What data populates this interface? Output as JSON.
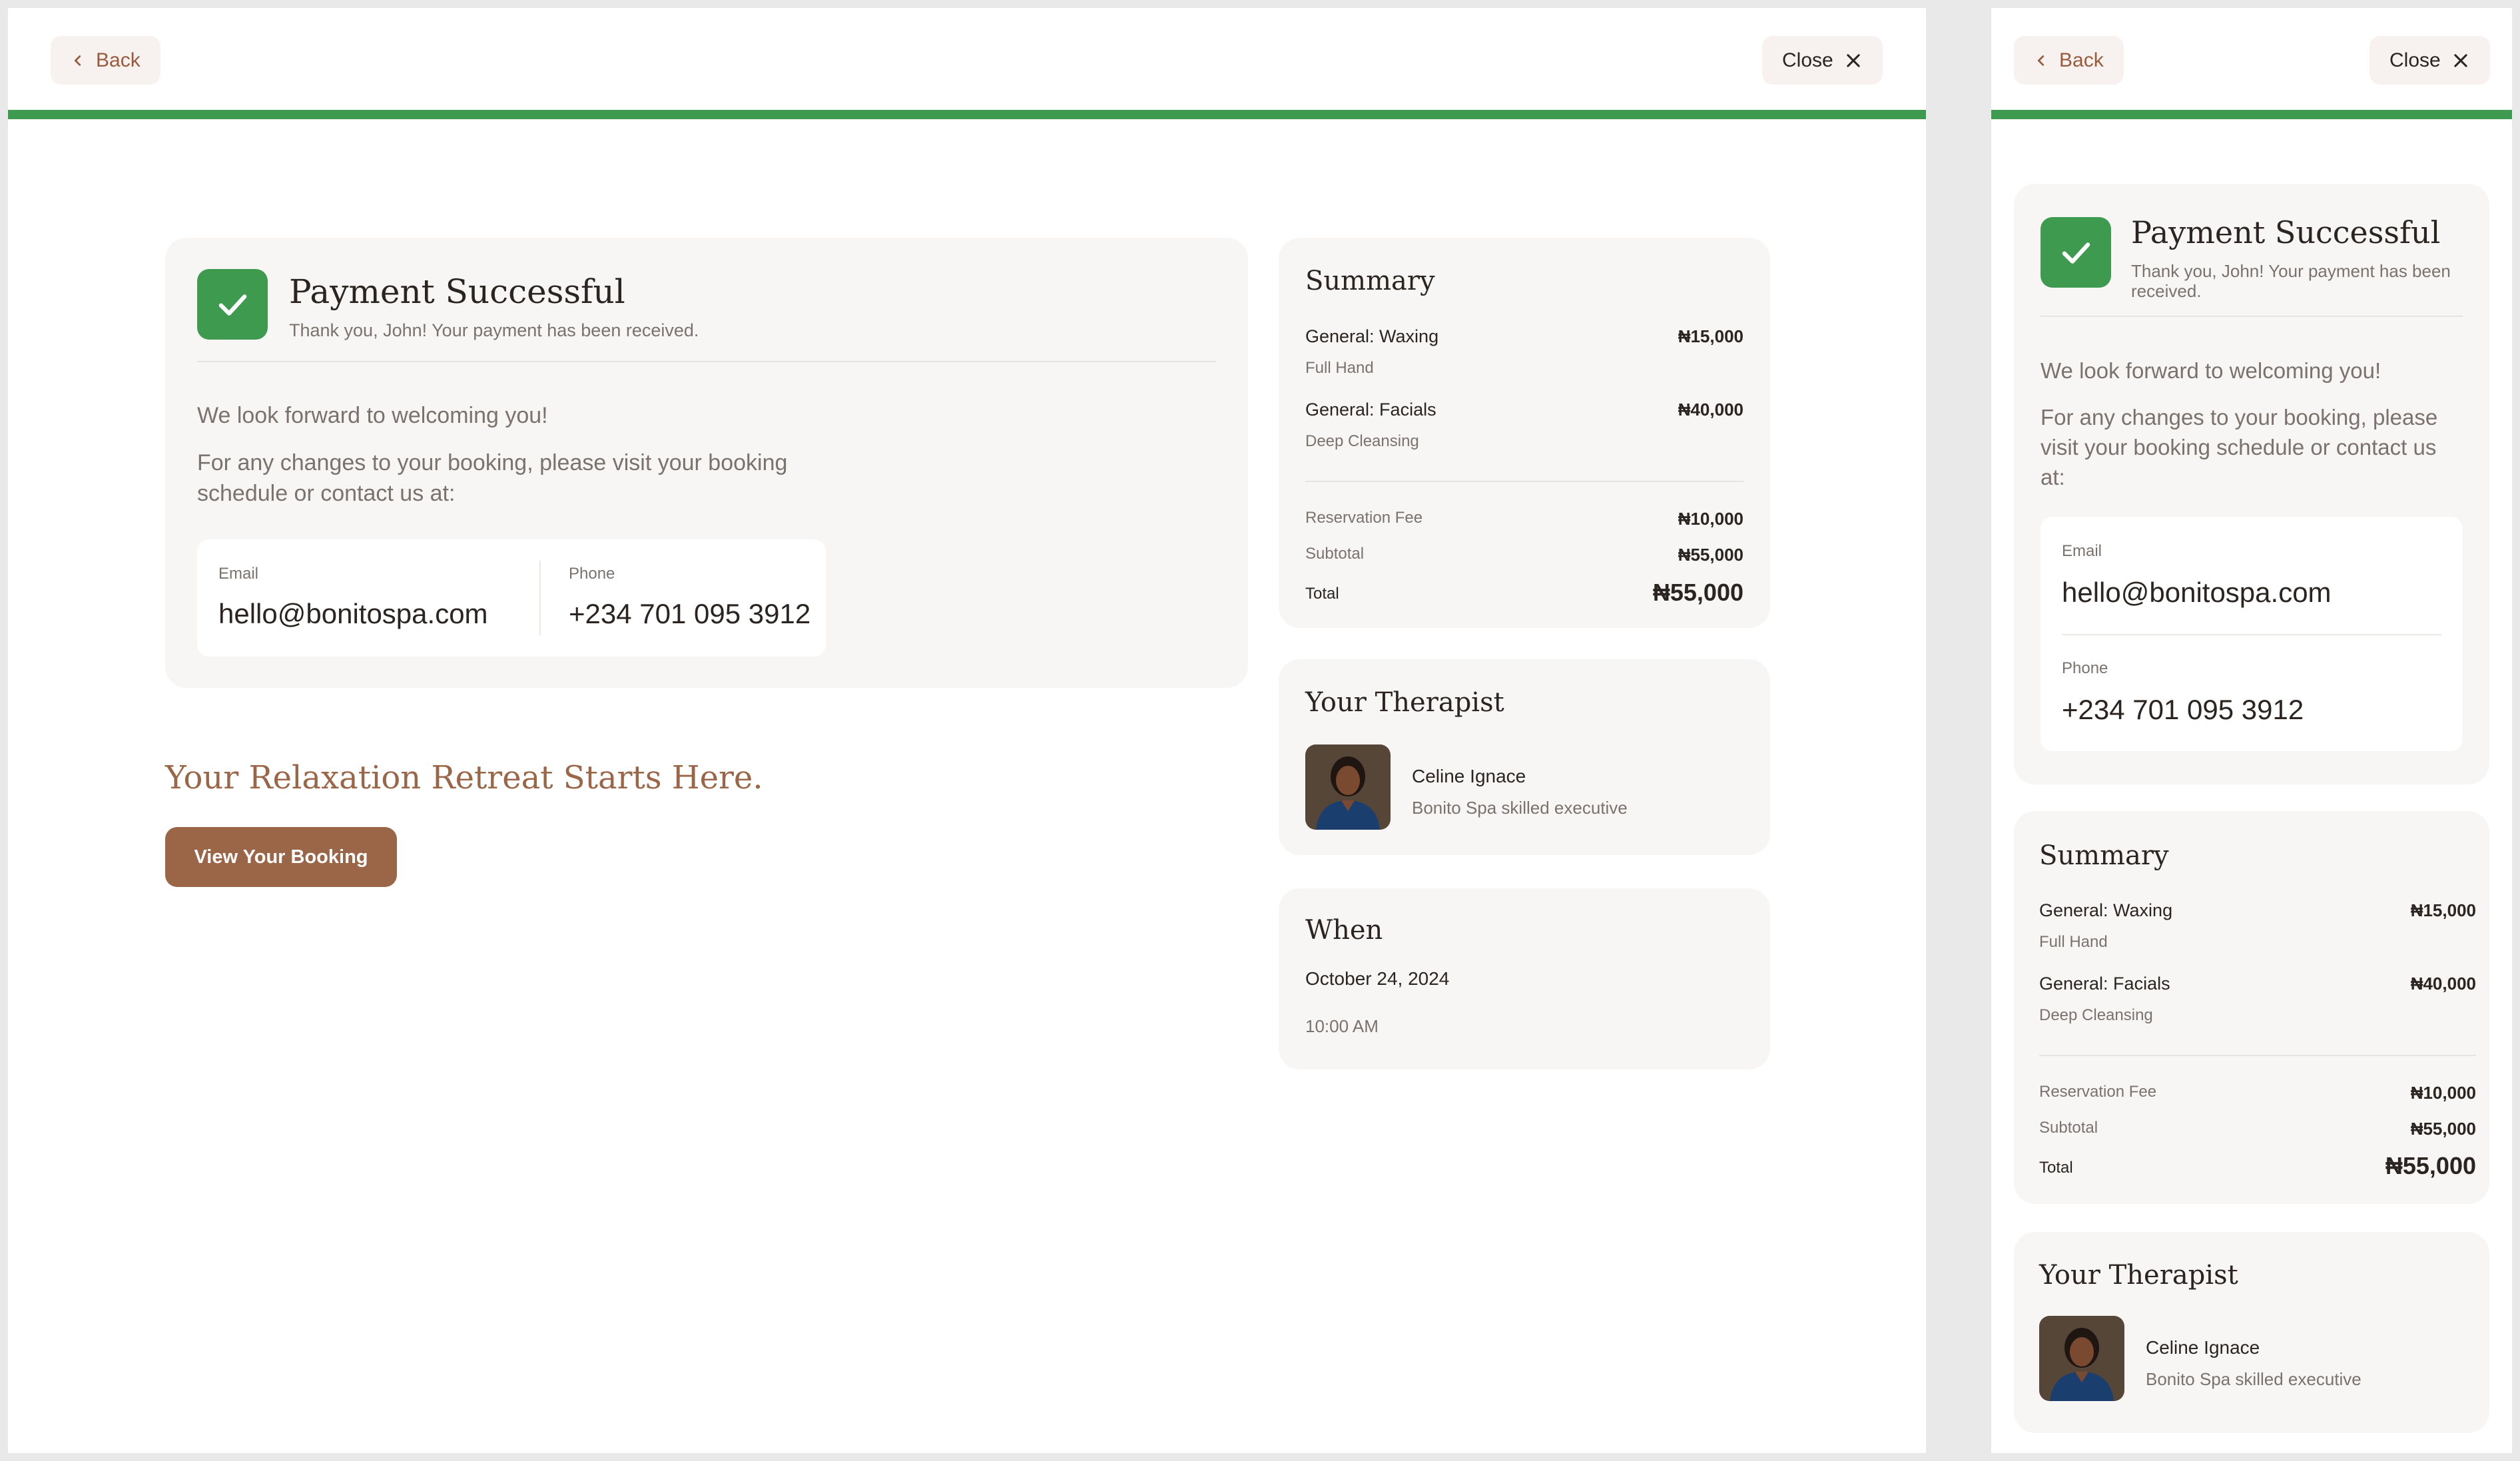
{
  "header": {
    "back_label": "Back",
    "close_label": "Close",
    "progress_percent": 100
  },
  "payment": {
    "title": "Payment Successful",
    "subtitle": "Thank you, John! Your payment has been received.",
    "welcome": "We look forward to welcoming you!",
    "changes_note": "For any changes to your booking, please visit your booking schedule or contact us at:"
  },
  "contact": {
    "email_label": "Email",
    "email": "hello@bonitospa.com",
    "phone_label": "Phone",
    "phone": "+234 701 095 3912"
  },
  "retreat": {
    "headline": "Your Relaxation Retreat Starts Here.",
    "cta_label": "View Your Booking"
  },
  "summary": {
    "title": "Summary",
    "items": [
      {
        "name": "General: Waxing",
        "detail": "Full Hand",
        "price": "₦15,000"
      },
      {
        "name": "General: Facials",
        "detail": "Deep Cleansing",
        "price": "₦40,000"
      }
    ],
    "reservation_label": "Reservation Fee",
    "reservation": "₦10,000",
    "subtotal_label": "Subtotal",
    "subtotal": "₦55,000",
    "total_label": "Total",
    "total": "₦55,000"
  },
  "therapist": {
    "title": "Your Therapist",
    "name": "Celine Ignace",
    "role": "Bonito Spa skilled executive"
  },
  "when": {
    "title": "When",
    "date": "October 24, 2024",
    "time": "10:00 AM"
  },
  "colors": {
    "accent_green": "#3d9a4f",
    "brand_brown": "#9a6647",
    "card_bg": "#f7f6f4"
  }
}
